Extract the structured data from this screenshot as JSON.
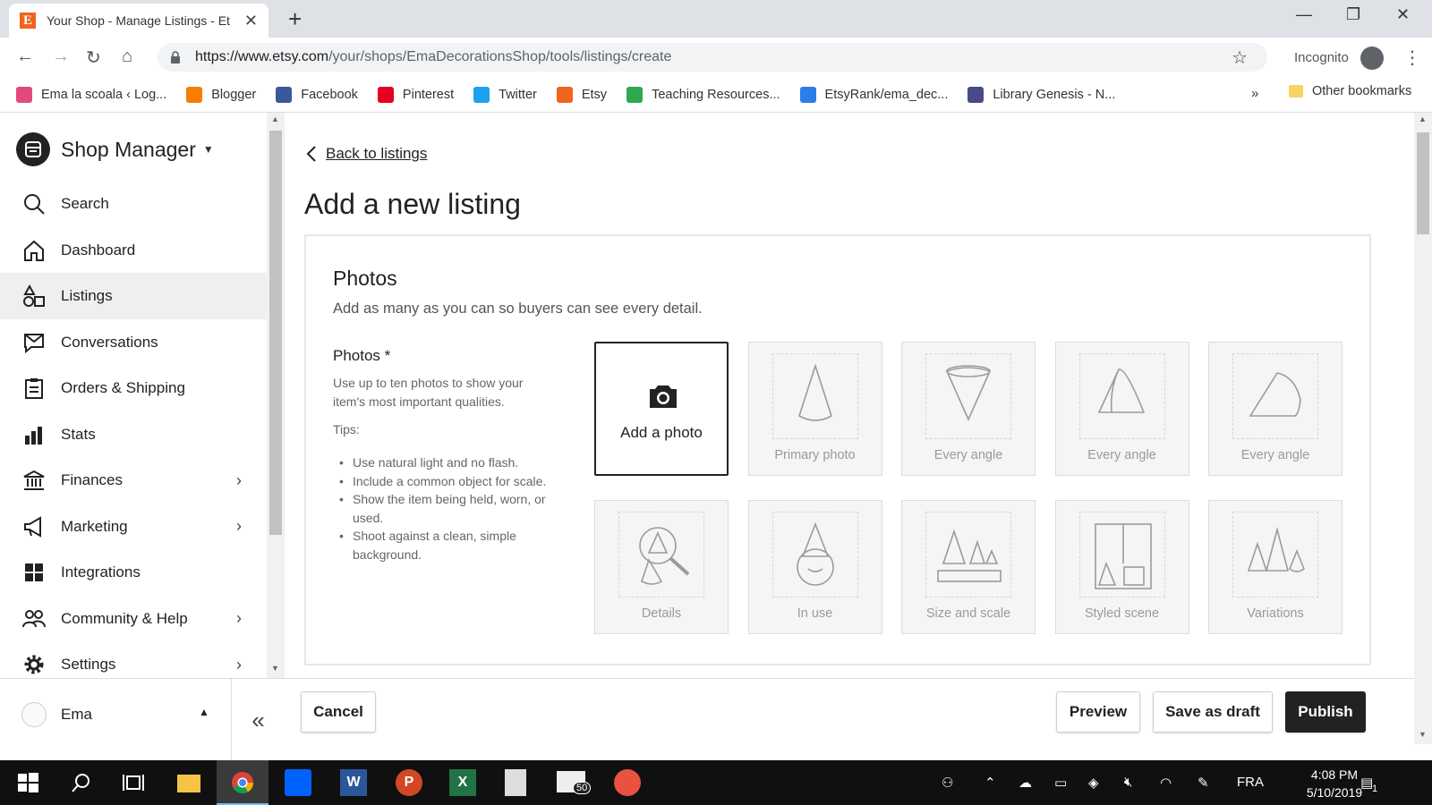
{
  "browser": {
    "tab_title": "Your Shop - Manage Listings - Et",
    "url_host": "https://www.etsy.com",
    "url_path": "/your/shops/EmaDecorationsShop/tools/listings/create",
    "incognito_label": "Incognito",
    "bookmarks": [
      {
        "label": "Ema la scoala ‹ Log...",
        "icon": "wordpress-icon",
        "color": "#e24a7e"
      },
      {
        "label": "Blogger",
        "icon": "blogger-icon",
        "color": "#f57d00"
      },
      {
        "label": "Facebook",
        "icon": "facebook-icon",
        "color": "#3b5998"
      },
      {
        "label": "Pinterest",
        "icon": "pinterest-icon",
        "color": "#e60023"
      },
      {
        "label": "Twitter",
        "icon": "twitter-icon",
        "color": "#1da1f2"
      },
      {
        "label": "Etsy",
        "icon": "etsy-icon",
        "color": "#f1641e"
      },
      {
        "label": "Teaching Resources...",
        "icon": "tpt-icon",
        "color": "#2fa84f"
      },
      {
        "label": "EtsyRank/ema_dec...",
        "icon": "etsyrank-icon",
        "color": "#2b7de9"
      },
      {
        "label": "Library Genesis - N...",
        "icon": "libgen-icon",
        "color": "#4a4a8a"
      }
    ],
    "bookmarks_overflow": "»",
    "other_bookmarks": "Other bookmarks"
  },
  "sidebar": {
    "title": "Shop Manager",
    "items": [
      {
        "label": "Search",
        "icon": "search-icon",
        "chevron": false
      },
      {
        "label": "Dashboard",
        "icon": "home-icon",
        "chevron": false
      },
      {
        "label": "Listings",
        "icon": "listings-icon",
        "chevron": false,
        "active": true
      },
      {
        "label": "Conversations",
        "icon": "conversations-icon",
        "chevron": false
      },
      {
        "label": "Orders & Shipping",
        "icon": "clipboard-icon",
        "chevron": false
      },
      {
        "label": "Stats",
        "icon": "bar-chart-icon",
        "chevron": false
      },
      {
        "label": "Finances",
        "icon": "bank-icon",
        "chevron": true
      },
      {
        "label": "Marketing",
        "icon": "megaphone-icon",
        "chevron": true
      },
      {
        "label": "Integrations",
        "icon": "grid-icon",
        "chevron": false
      },
      {
        "label": "Community & Help",
        "icon": "people-icon",
        "chevron": true
      },
      {
        "label": "Settings",
        "icon": "gear-icon",
        "chevron": true
      }
    ],
    "user_name": "Ema"
  },
  "main": {
    "back_link": "Back to listings",
    "page_title": "Add a new listing",
    "photos": {
      "section_title": "Photos",
      "section_subtitle": "Add as many as you can so buyers can see every detail.",
      "field_label": "Photos *",
      "field_description": "Use up to ten photos to show your item's most important qualities.",
      "tips_label": "Tips:",
      "tips": [
        "Use natural light and no flash.",
        "Include a common object for scale.",
        "Show the item being held, worn, or used.",
        "Shoot against a clean, simple background."
      ],
      "add_photo_label": "Add a photo",
      "tiles": [
        {
          "caption": "Primary photo"
        },
        {
          "caption": "Every angle"
        },
        {
          "caption": "Every angle"
        },
        {
          "caption": "Every angle"
        },
        {
          "caption": "Details"
        },
        {
          "caption": "In use"
        },
        {
          "caption": "Size and scale"
        },
        {
          "caption": "Styled scene"
        },
        {
          "caption": "Variations"
        }
      ]
    }
  },
  "actions": {
    "cancel": "Cancel",
    "preview": "Preview",
    "save_draft": "Save as draft",
    "publish": "Publish"
  },
  "taskbar": {
    "language": "FRA",
    "time": "4:08 PM",
    "date": "5/10/2019",
    "mail_badge": "50",
    "notification_count": "1"
  }
}
